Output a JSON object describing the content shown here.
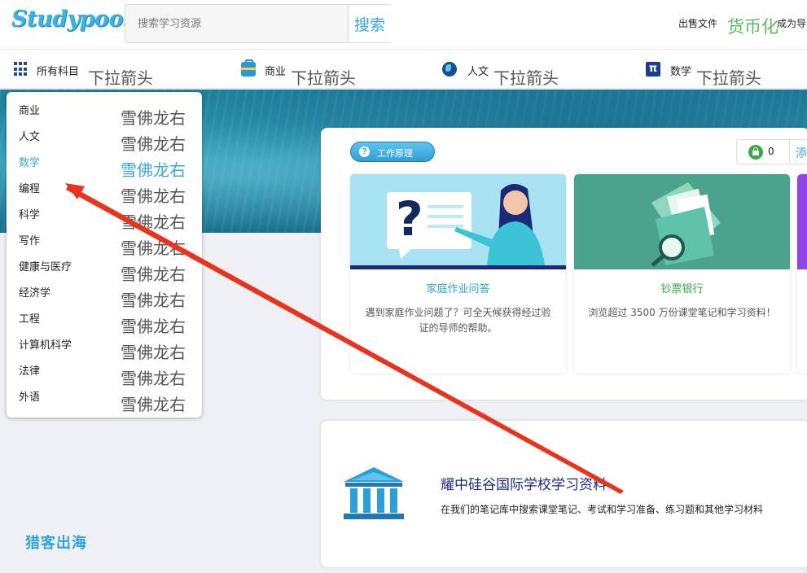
{
  "header": {
    "logo_text": "Studypool",
    "search_placeholder": "搜索学习资源",
    "search_button": "搜索",
    "sell_link": "出售文件",
    "currency_link": "货币化",
    "tutor_link": "成为导"
  },
  "nav": {
    "categories": [
      {
        "label": "所有科目",
        "arrow": "下拉箭头",
        "icon": "grid-icon"
      },
      {
        "label": "商业",
        "arrow": "下拉箭头",
        "icon": "briefcase-icon"
      },
      {
        "label": "人文",
        "arrow": "下拉箭头",
        "icon": "globe-icon"
      },
      {
        "label": "数学",
        "arrow": "下拉箭头",
        "icon": "pi-icon"
      }
    ]
  },
  "dropdown": {
    "active_index": 2,
    "items": [
      {
        "label": "商业",
        "arrow": "雪佛龙右"
      },
      {
        "label": "人文",
        "arrow": "雪佛龙右"
      },
      {
        "label": "数学",
        "arrow": "雪佛龙右"
      },
      {
        "label": "编程",
        "arrow": "雪佛龙右"
      },
      {
        "label": "科学",
        "arrow": "雪佛龙右"
      },
      {
        "label": "写作",
        "arrow": "雪佛龙右"
      },
      {
        "label": "健康与医疗",
        "arrow": "雪佛龙右"
      },
      {
        "label": "经济学",
        "arrow": "雪佛龙右"
      },
      {
        "label": "工程",
        "arrow": "雪佛龙右"
      },
      {
        "label": "计算机科学",
        "arrow": "雪佛龙右"
      },
      {
        "label": "法律",
        "arrow": "雪佛龙右"
      },
      {
        "label": "外语",
        "arrow": "雪佛龙右"
      }
    ]
  },
  "main": {
    "how_it_works": "工作原理",
    "wallet_count": "0",
    "wallet_add": "添",
    "features": [
      {
        "title": "家庭作业问答",
        "desc": "遇到家庭作业问题了？可全天候获得经过验证的导师的帮助。",
        "color": "#2aa6c9"
      },
      {
        "title": "钞票银行",
        "desc": "浏览超过 3500 万份课堂笔记和学习资料！",
        "color": "#3daa4a"
      }
    ]
  },
  "school": {
    "title": "耀中硅谷国际学校学习资料",
    "desc": "在我们的笔记库中搜索课堂笔记、考试和学习准备、练习题和其他学习材料"
  },
  "watermark": "猎客出海",
  "colors": {
    "accent": "#3aa8d8",
    "green": "#5cb85c",
    "arrow_annotation": "#e8341f"
  }
}
